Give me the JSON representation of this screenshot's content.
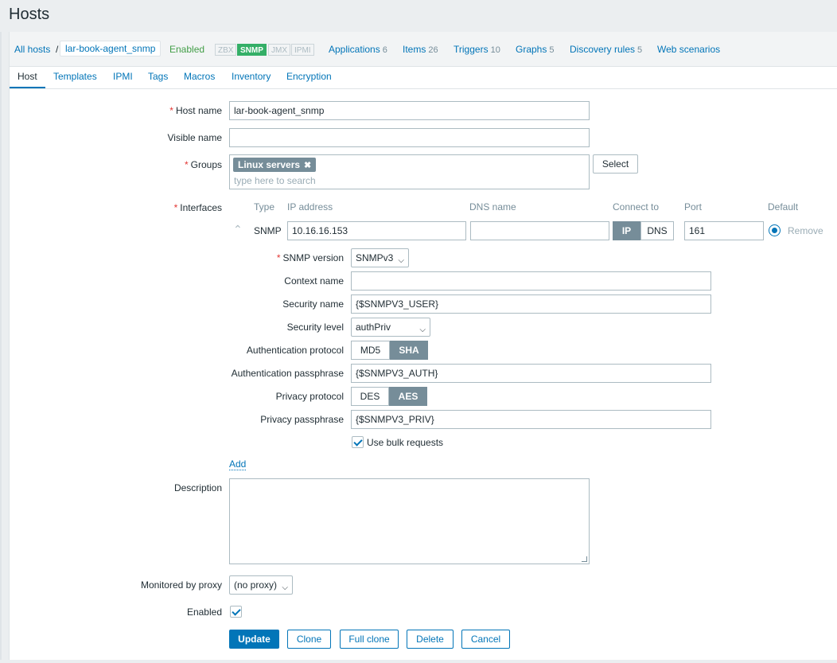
{
  "page_title": "Hosts",
  "hostnav": {
    "all_hosts": "All hosts",
    "separator": "/",
    "current_host": "lar-book-agent_snmp",
    "status": "Enabled",
    "availability": [
      {
        "label": "ZBX",
        "active": false
      },
      {
        "label": "SNMP",
        "active": true
      },
      {
        "label": "JMX",
        "active": false
      },
      {
        "label": "IPMI",
        "active": false
      }
    ],
    "links": [
      {
        "label": "Applications",
        "count": "6"
      },
      {
        "label": "Items",
        "count": "26"
      },
      {
        "label": "Triggers",
        "count": "10"
      },
      {
        "label": "Graphs",
        "count": "5"
      },
      {
        "label": "Discovery rules",
        "count": "5"
      },
      {
        "label": "Web scenarios",
        "count": ""
      }
    ]
  },
  "tabs": [
    "Host",
    "Templates",
    "IPMI",
    "Tags",
    "Macros",
    "Inventory",
    "Encryption"
  ],
  "form": {
    "host_name_label": "Host name",
    "host_name_value": "lar-book-agent_snmp",
    "visible_name_label": "Visible name",
    "visible_name_value": "",
    "groups_label": "Groups",
    "group_chip": "Linux servers",
    "group_chip_remove": "✖",
    "groups_placeholder": "type here to search",
    "select_button": "Select",
    "interfaces_label": "Interfaces",
    "iface_headers": {
      "type": "Type",
      "ip": "IP address",
      "dns": "DNS name",
      "connect": "Connect to",
      "port": "Port",
      "default": "Default"
    },
    "iface": {
      "type": "SNMP",
      "ip": "10.16.16.153",
      "dns": "",
      "connect_ip": "IP",
      "connect_dns": "DNS",
      "port": "161",
      "remove": "Remove"
    },
    "snmp": {
      "version_label": "SNMP version",
      "version_value": "SNMPv3",
      "context_label": "Context name",
      "context_value": "",
      "security_name_label": "Security name",
      "security_name_value": "{$SNMPV3_USER}",
      "security_level_label": "Security level",
      "security_level_value": "authPriv",
      "auth_protocol_label": "Authentication protocol",
      "auth_md5": "MD5",
      "auth_sha": "SHA",
      "auth_pass_label": "Authentication passphrase",
      "auth_pass_value": "{$SNMPV3_AUTH}",
      "priv_protocol_label": "Privacy protocol",
      "priv_des": "DES",
      "priv_aes": "AES",
      "priv_pass_label": "Privacy passphrase",
      "priv_pass_value": "{$SNMPV3_PRIV}",
      "bulk_label": "Use bulk requests"
    },
    "add_link": "Add",
    "description_label": "Description",
    "proxy_label": "Monitored by proxy",
    "proxy_value": "(no proxy)",
    "enabled_label": "Enabled",
    "buttons": {
      "update": "Update",
      "clone": "Clone",
      "full_clone": "Full clone",
      "delete": "Delete",
      "cancel": "Cancel"
    }
  },
  "colors": {
    "link": "#0275b8",
    "enabled": "#429e47",
    "snmp_badge": "#34af67",
    "required": "#e33734",
    "segment_on": "#768d99"
  }
}
